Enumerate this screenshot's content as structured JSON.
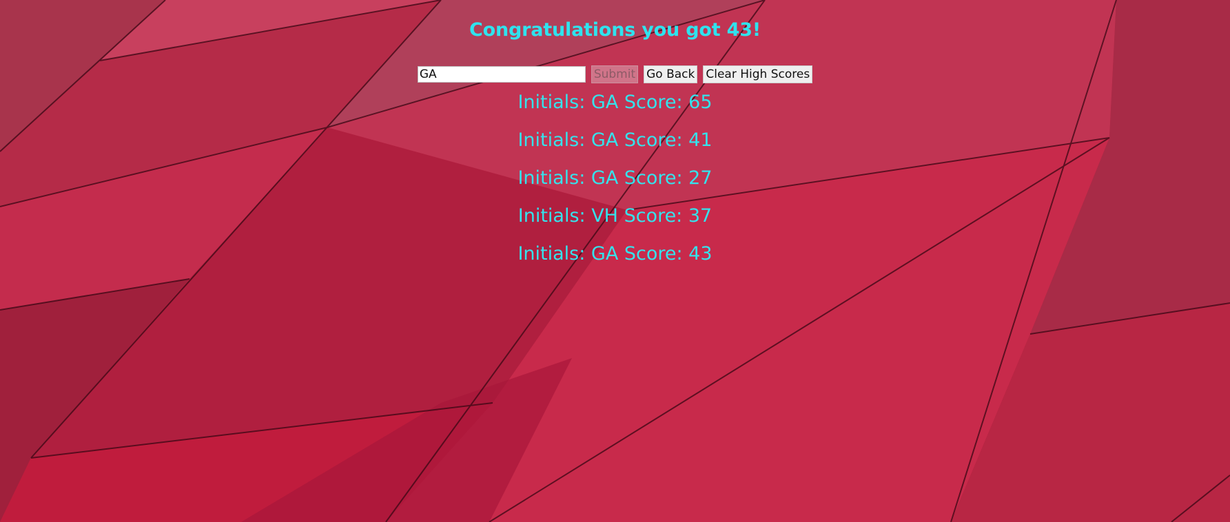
{
  "header": {
    "title": "Congratulations you got 43!"
  },
  "form": {
    "initials_value": "GA",
    "submit_label": "Submit",
    "go_back_label": "Go Back",
    "clear_label": "Clear High Scores"
  },
  "scores": [
    "Initials: GA Score: 65",
    "Initials: GA Score: 41",
    "Initials: GA Score: 27",
    "Initials: VH Score: 37",
    "Initials: GA Score: 43"
  ],
  "colors": {
    "accent": "#35e2ec",
    "background": "#c22a4a"
  }
}
